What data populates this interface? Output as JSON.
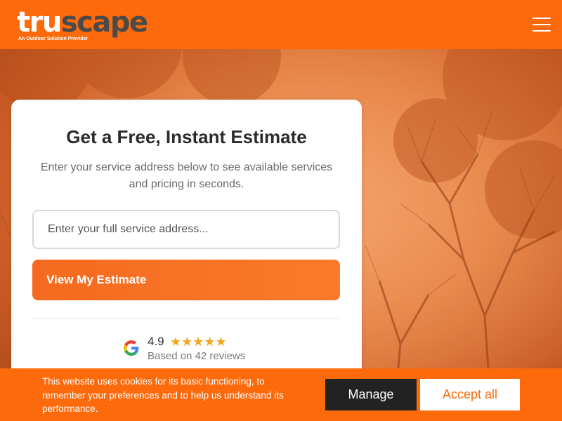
{
  "header": {
    "logo_part1": "tru",
    "logo_part2": "scape",
    "logo_tagline": "An Outdoor Solution Provider",
    "menu_icon": "hamburger-menu-icon"
  },
  "estimate_card": {
    "title": "Get a Free, Instant Estimate",
    "subtitle": "Enter your service address below to see available services and pricing in seconds.",
    "address_placeholder": "Enter your full service address...",
    "address_value": "",
    "cta_label": "View My Estimate",
    "rating": {
      "provider_icon": "google-icon",
      "score": "4.9",
      "stars": "★★★★★",
      "stars_value": 4.9,
      "reviews_text": "Based on 42 reviews"
    }
  },
  "cookie_banner": {
    "text": "This website uses cookies for its basic functioning, to remember your preferences and to help us understand its performance.",
    "manage_label": "Manage",
    "accept_label": "Accept all"
  },
  "colors": {
    "brand_orange": "#fd6a0c",
    "logo_gray": "#4a4a4a",
    "star_gold": "#f2a51b",
    "manage_bg": "#222222"
  }
}
